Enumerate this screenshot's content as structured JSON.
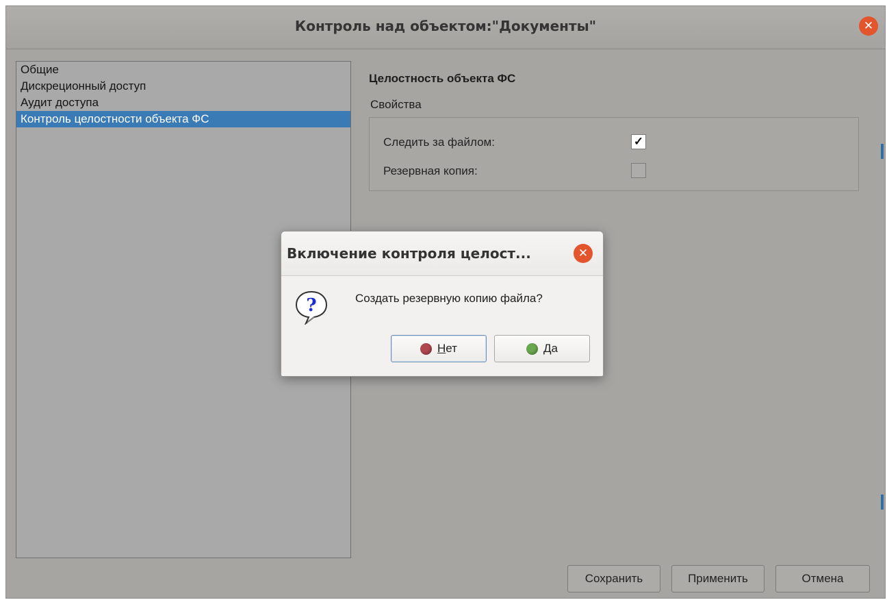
{
  "window": {
    "title": "Контроль над объектом:\"Документы\"",
    "close_glyph": "✕"
  },
  "nav": {
    "items": [
      {
        "label": "Общие",
        "selected": false
      },
      {
        "label": "Дискреционный доступ",
        "selected": false
      },
      {
        "label": "Аудит доступа",
        "selected": false
      },
      {
        "label": "Контроль целостности объекта ФС",
        "selected": true
      }
    ]
  },
  "properties": {
    "heading": "Целостность объекта ФС",
    "group_label": "Свойства",
    "rows": [
      {
        "label": "Следить за файлом:",
        "checked": true,
        "check_glyph": "✓"
      },
      {
        "label": "Резервная копия:",
        "checked": false
      }
    ]
  },
  "footer": {
    "save_label": "Сохранить",
    "apply_label": "Применить",
    "cancel_label": "Отмена"
  },
  "dialog": {
    "title": "Включение контроля целост...",
    "close_glyph": "✕",
    "message": "Создать резервную копию файла?",
    "no_label": "Нет",
    "yes_label": "Да",
    "icon": "question-icon"
  },
  "colors": {
    "accent_close": "#e2552d",
    "selection": "#3a7bb6",
    "no_button_icon": "#b0474f",
    "yes_button_icon": "#6aa84f"
  }
}
